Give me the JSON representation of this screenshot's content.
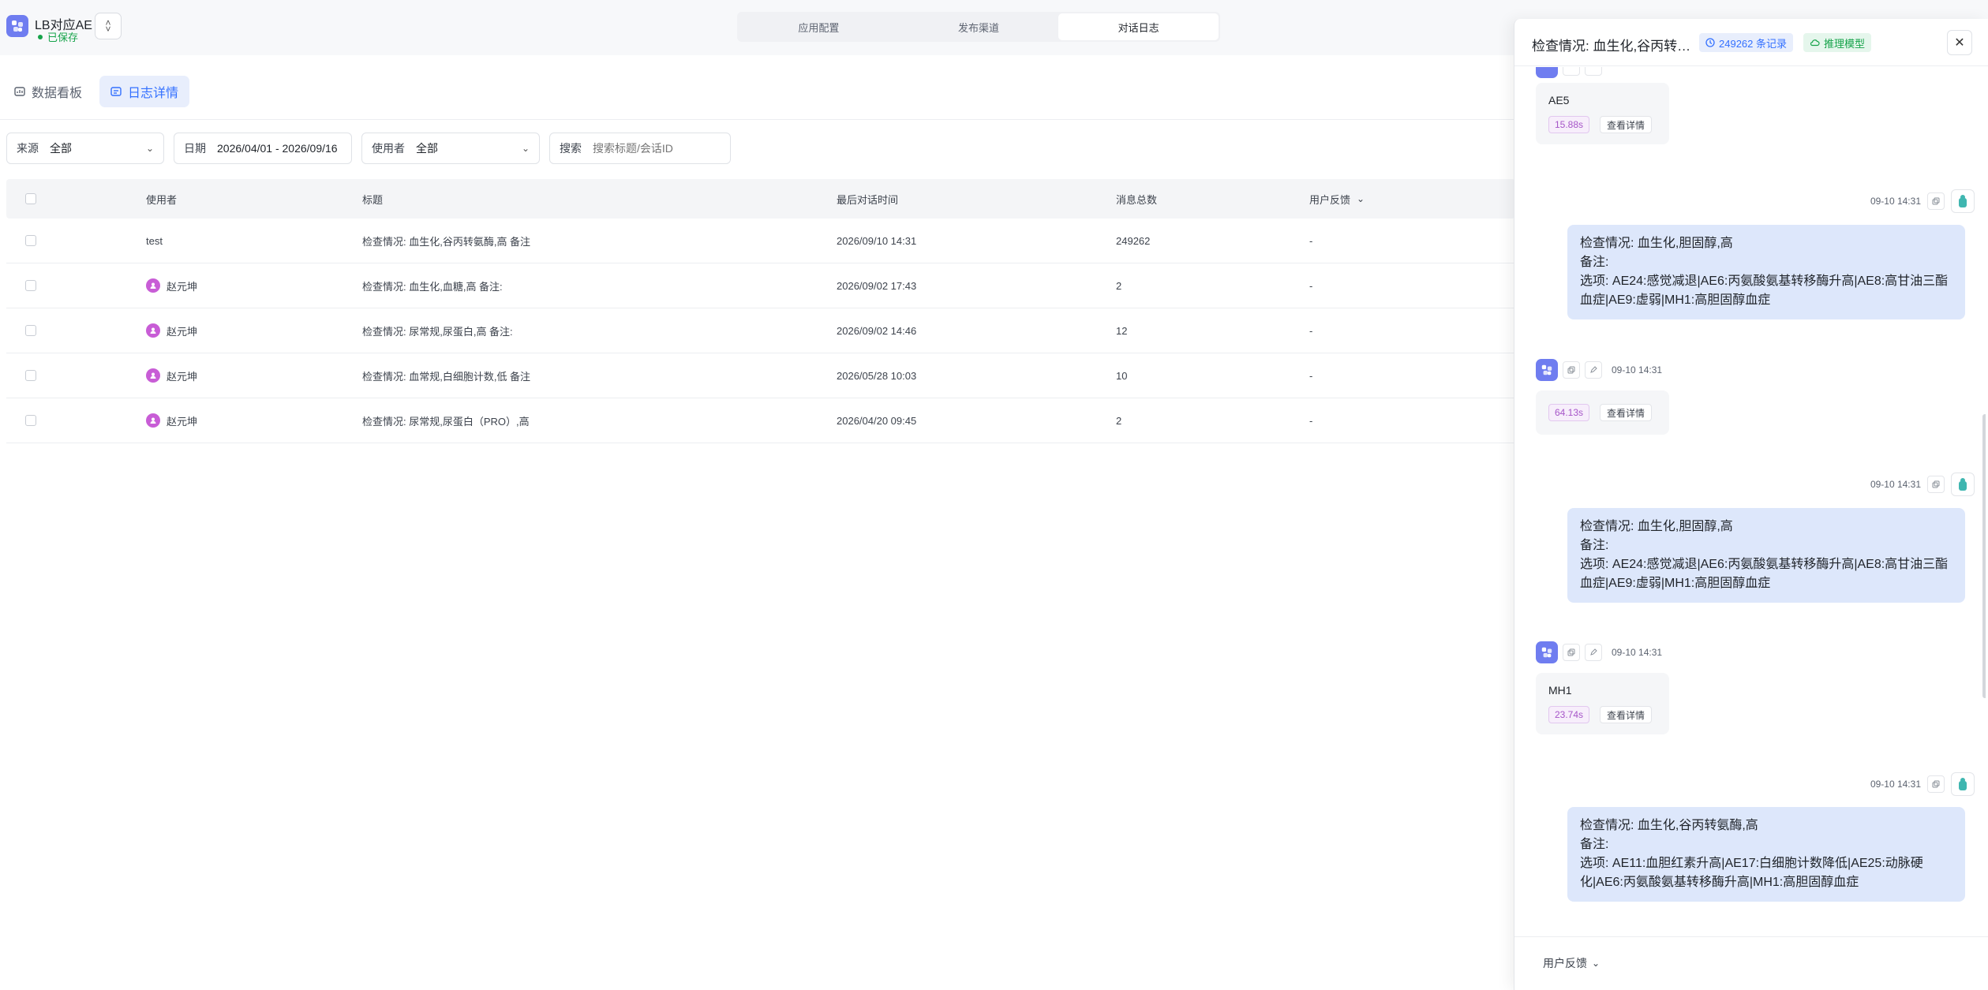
{
  "header": {
    "app_name": "LB对应AE",
    "saved_label": "已保存",
    "tabs": [
      {
        "label": "应用配置",
        "active": false
      },
      {
        "label": "发布渠道",
        "active": false
      },
      {
        "label": "对话日志",
        "active": true
      }
    ]
  },
  "subnav": [
    {
      "label": "数据看板",
      "active": false
    },
    {
      "label": "日志详情",
      "active": true
    }
  ],
  "filters": {
    "source": {
      "label": "来源",
      "value": "全部"
    },
    "date": {
      "label": "日期",
      "value": "2026/04/01 - 2026/09/16"
    },
    "user": {
      "label": "使用者",
      "value": "全部"
    },
    "search": {
      "label": "搜索",
      "placeholder": "搜索标题/会话ID"
    }
  },
  "table": {
    "headers": {
      "user": "使用者",
      "title": "标题",
      "time": "最后对话时间",
      "count": "消息总数",
      "feedback": "用户反馈"
    },
    "rows": [
      {
        "user": "test",
        "has_avatar": false,
        "title": "检查情况: 血生化,谷丙转氨酶,高 备注",
        "time": "2026/09/10 14:31",
        "count": "249262",
        "feedback": "-"
      },
      {
        "user": "赵元坤",
        "has_avatar": true,
        "title": "检查情况: 血生化,血糖,高 备注:",
        "time": "2026/09/02 17:43",
        "count": "2",
        "feedback": "-"
      },
      {
        "user": "赵元坤",
        "has_avatar": true,
        "title": "检查情况: 尿常规,尿蛋白,高 备注:",
        "time": "2026/09/02 14:46",
        "count": "12",
        "feedback": "-"
      },
      {
        "user": "赵元坤",
        "has_avatar": true,
        "title": "检查情况: 血常规,白细胞计数,低 备注",
        "time": "2026/05/28 10:03",
        "count": "10",
        "feedback": "-"
      },
      {
        "user": "赵元坤",
        "has_avatar": true,
        "title": "检查情况: 尿常规,尿蛋白（PRO）,高",
        "time": "2026/04/20 09:45",
        "count": "2",
        "feedback": "-"
      }
    ]
  },
  "drawer": {
    "title": "检查情况: 血生化,谷丙转氨...",
    "record_tag": "249262 条记录",
    "model_tag": "推理模型",
    "footer_feedback": "用户反馈",
    "messages": [
      {
        "role": "ai",
        "text": "AE5",
        "duration": "15.88s",
        "detail": "查看详情"
      },
      {
        "role": "user",
        "time": "09-10 14:31",
        "lines": [
          "检查情况: 血生化,胆固醇,高",
          "备注:",
          "选项: AE24:感觉减退|AE6:丙氨酸氨基转移酶升高|AE8:高甘油三酯血症|AE9:虚弱|MH1:高胆固醇血症"
        ]
      },
      {
        "role": "ai",
        "time": "09-10 14:31",
        "text": "",
        "duration": "64.13s",
        "detail": "查看详情"
      },
      {
        "role": "user",
        "time": "09-10 14:31",
        "lines": [
          "检查情况: 血生化,胆固醇,高",
          "备注:",
          "选项: AE24:感觉减退|AE6:丙氨酸氨基转移酶升高|AE8:高甘油三酯血症|AE9:虚弱|MH1:高胆固醇血症"
        ]
      },
      {
        "role": "ai",
        "time": "09-10 14:31",
        "text": "MH1",
        "duration": "23.74s",
        "detail": "查看详情"
      },
      {
        "role": "user",
        "time": "09-10 14:31",
        "lines": [
          "检查情况: 血生化,谷丙转氨酶,高",
          "备注:",
          "选项: AE11:血胆红素升高|AE17:白细胞计数降低|AE25:动脉硬化|AE6:丙氨酸氨基转移酶升高|MH1:高胆固醇血症"
        ]
      }
    ]
  },
  "colors": {
    "accent": "#3370ff",
    "brand": "#6f7df0",
    "saved": "#16a34a",
    "user_bubble": "#dde7fb"
  }
}
